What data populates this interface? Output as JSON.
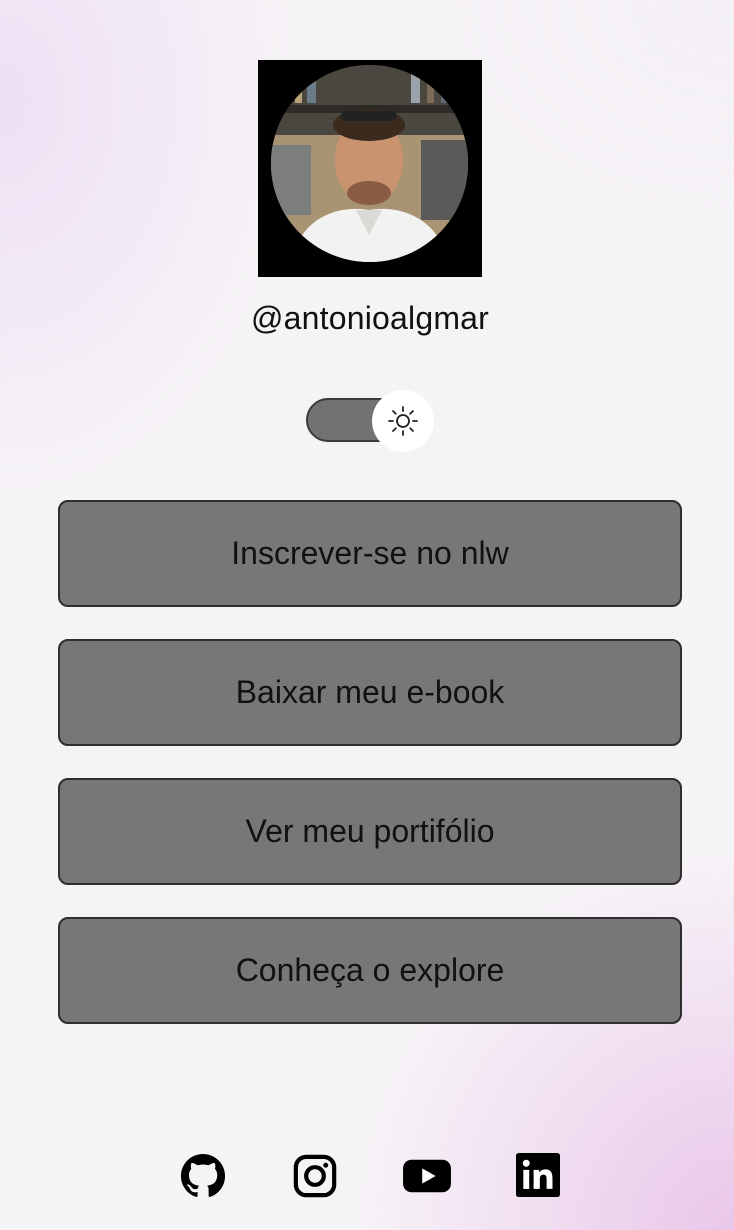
{
  "profile": {
    "username": "@antonioalgmar",
    "avatar_alt": "profile photo"
  },
  "theme_switch": {
    "mode": "light",
    "icon": "sun-icon"
  },
  "links": [
    {
      "label": "Inscrever-se no nlw"
    },
    {
      "label": "Baixar meu e-book"
    },
    {
      "label": "Ver meu portifólio"
    },
    {
      "label": "Conheça o explore"
    }
  ],
  "socials": [
    {
      "icon": "github-icon"
    },
    {
      "icon": "instagram-icon"
    },
    {
      "icon": "youtube-icon"
    },
    {
      "icon": "linkedin-icon"
    }
  ],
  "colors": {
    "button_bg": "#777777",
    "button_border": "#2e2e2e",
    "background_tint": "#e9c4e8",
    "text": "#111111"
  }
}
